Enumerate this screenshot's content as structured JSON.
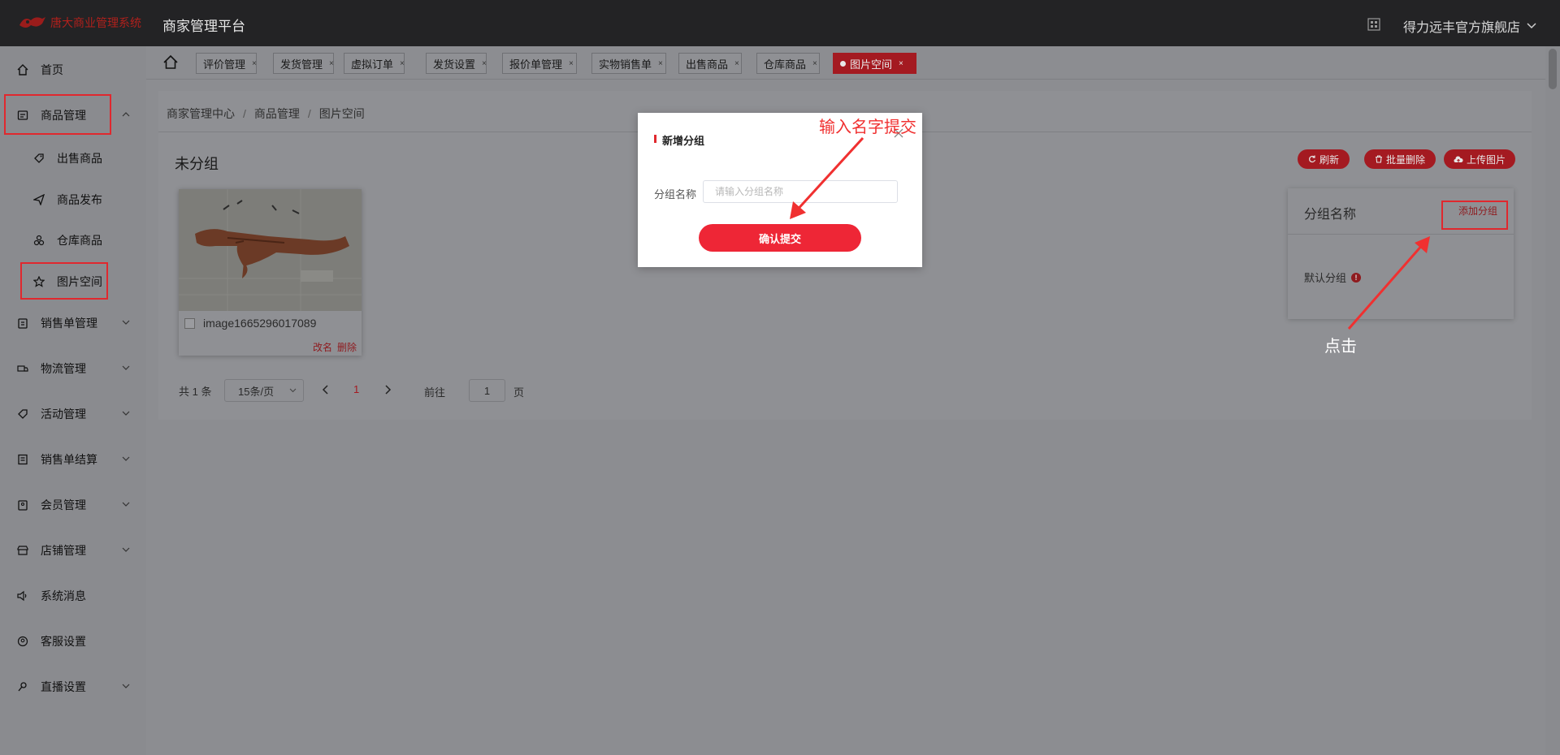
{
  "topbar": {
    "logo_text": "唐大商业管理系统",
    "platform_title": "商家管理平台",
    "store_name": "得力远丰官方旗舰店"
  },
  "sidebar": {
    "items": [
      {
        "label": "首页",
        "icon": "home-icon"
      },
      {
        "label": "商品管理",
        "icon": "goods-icon",
        "expanded": true
      },
      {
        "label": "出售商品",
        "icon": "tag-icon",
        "sub": true
      },
      {
        "label": "商品发布",
        "icon": "send-icon",
        "sub": true
      },
      {
        "label": "仓库商品",
        "icon": "warehouse-icon",
        "sub": true
      },
      {
        "label": "图片空间",
        "icon": "star-icon",
        "sub": true
      },
      {
        "label": "销售单管理",
        "icon": "clipboard-icon"
      },
      {
        "label": "物流管理",
        "icon": "truck-icon"
      },
      {
        "label": "活动管理",
        "icon": "ticket-icon"
      },
      {
        "label": "销售单结算",
        "icon": "ledger-icon"
      },
      {
        "label": "会员管理",
        "icon": "member-icon"
      },
      {
        "label": "店铺管理",
        "icon": "shop-icon"
      },
      {
        "label": "系统消息",
        "icon": "speaker-icon"
      },
      {
        "label": "客服设置",
        "icon": "service-icon"
      },
      {
        "label": "直播设置",
        "icon": "live-icon"
      }
    ]
  },
  "tabs": [
    {
      "label": "评价管理"
    },
    {
      "label": "发货管理"
    },
    {
      "label": "虚拟订单"
    },
    {
      "label": "发货设置"
    },
    {
      "label": "报价单管理"
    },
    {
      "label": "实物销售单"
    },
    {
      "label": "出售商品"
    },
    {
      "label": "仓库商品"
    },
    {
      "label": "图片空间",
      "active": true
    }
  ],
  "tab_close": "×",
  "breadcrumb": [
    "商家管理中心",
    "商品管理",
    "图片空间"
  ],
  "breadcrumb_sep": "/",
  "section_title": "未分组",
  "actions": {
    "refresh": "刷新",
    "batch_delete": "批量删除",
    "upload": "上传图片"
  },
  "image_card": {
    "name": "image1665296017089",
    "rename": "改名",
    "delete": "删除"
  },
  "pagination": {
    "total": "共 1 条",
    "page_size": "15条/页",
    "current_page": "1",
    "goto_label": "前往",
    "goto_value": "1",
    "page_unit": "页"
  },
  "group_panel": {
    "header": "分组名称",
    "add_label": "添加分组",
    "default_group": "默认分组"
  },
  "modal": {
    "title": "新增分组",
    "field_label": "分组名称",
    "placeholder": "请输入分组名称",
    "submit": "确认提交"
  },
  "annotations": {
    "input_hint": "输入名字提交",
    "click_hint": "点击"
  },
  "colors": {
    "accent": "#ee2636",
    "annotation": "#f03030",
    "topbar": "#232325"
  }
}
